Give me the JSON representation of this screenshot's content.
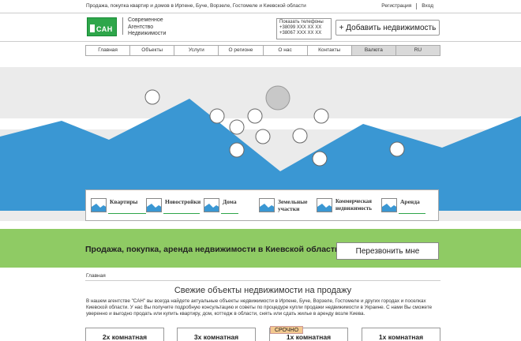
{
  "topbar": {
    "tagline": "Продажа, покупка квартир и домов в Ирпене, Буче, Ворзеле, Гостомеле и Киевской области",
    "register": "Регистрация",
    "login": "Вход"
  },
  "header": {
    "logo_text": "САН",
    "company_lines": [
      "Современное",
      "Агентство",
      "Недвижимости"
    ],
    "phones_label": "Показать телефоны",
    "phones": [
      "+38099 XXX XX XX",
      "+38067 XXX XX XX"
    ],
    "add_button": "+ Добавить недвижимость"
  },
  "nav": {
    "items": [
      "Главная",
      "Объекты",
      "Услуги",
      "О регионе",
      "О нас",
      "Контакты",
      "Валюта",
      "RU"
    ]
  },
  "categories": [
    {
      "label": "Квартиры"
    },
    {
      "label": "Новостройки"
    },
    {
      "label": "Дома"
    },
    {
      "label": "Земельные участки"
    },
    {
      "label": "Коммерческая недвижимость"
    },
    {
      "label": "Аренда"
    }
  ],
  "band": {
    "title": "Продажа, покупка, аренда недвижимости в Киевской области",
    "call_button": "Перезвонить мне"
  },
  "breadcrumb": "Главная",
  "section_title": "Свежие объекты недвижимости на продажу",
  "intro_text": "В нашем агентстве \"САН\" вы всегда найдете актуальные объекты недвижимости в Ирпене, Буче, Ворзеле, Гостомеле и других городах и поселках Киевской области. У нас Вы получите подробную консультацию и советы по процедуре купли продажи недвижимости в Украине. С нами Вы сможете уверенно и выгодно продать или купить квартиру, дом, коттедж в области, снять или сдать жилье в аренду возле Киева.",
  "badge": "СРОЧНО",
  "cards": [
    "2х комнатная",
    "3х комнатная",
    "1х комнатная",
    "1х комнатная"
  ],
  "colors": {
    "green": "#2ea64a",
    "band_green": "#8fcb64",
    "mountain_blue": "#3a97d3"
  }
}
